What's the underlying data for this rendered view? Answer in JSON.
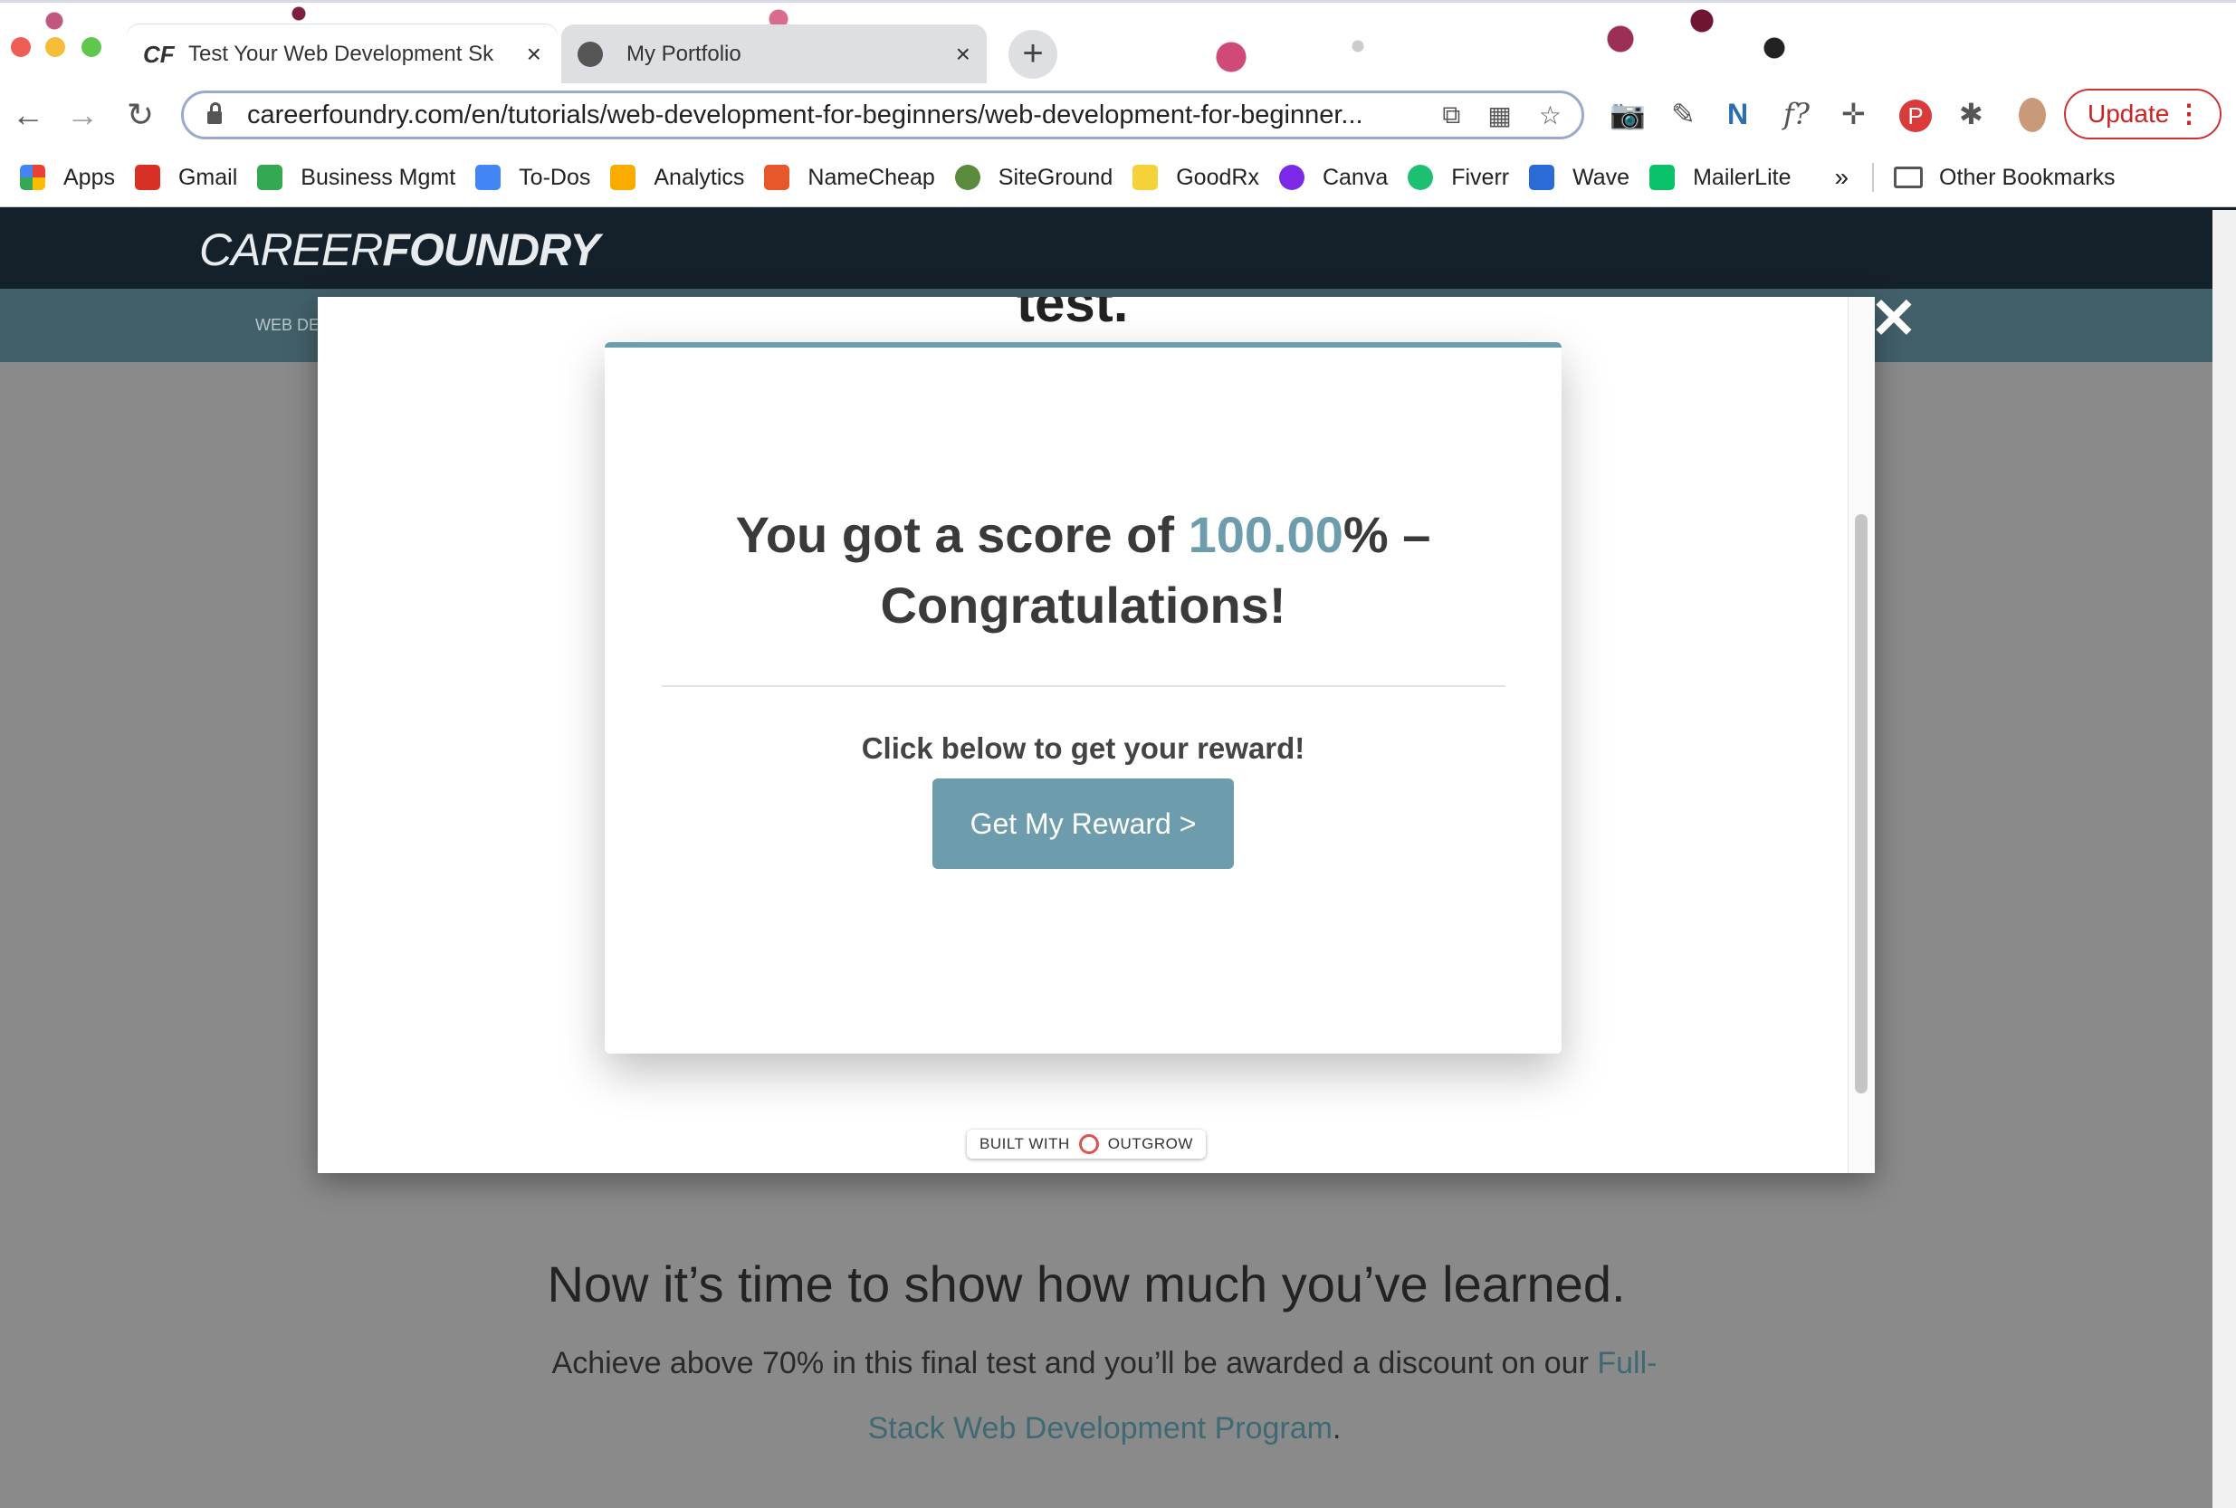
{
  "browser": {
    "tabs": [
      {
        "favicon": "CF",
        "title": "Test Your Web Development Sk",
        "close": "×",
        "active": true
      },
      {
        "favicon": "globe-icon",
        "title": "My Portfolio",
        "close": "×",
        "active": false
      }
    ],
    "new_tab": "+",
    "nav": {
      "back": "←",
      "forward": "→",
      "reload": "↻"
    },
    "url": "careerfoundry.com/en/tutorials/web-development-for-beginners/web-development-for-beginner...",
    "omnibox_icons": [
      "⧉",
      "▦",
      "☆"
    ],
    "extensions": [
      "📷",
      "✎",
      "N",
      "f?",
      "✛",
      "P",
      "✱"
    ],
    "update_label": "Update",
    "update_menu": "⋮"
  },
  "bookmarks": {
    "items": [
      {
        "label": "Apps",
        "color": "#e94235"
      },
      {
        "label": "Gmail",
        "color": "#d93025"
      },
      {
        "label": "Business Mgmt",
        "color": "#34a853"
      },
      {
        "label": "To-Dos",
        "color": "#4285f4"
      },
      {
        "label": "Analytics",
        "color": "#f9ab00"
      },
      {
        "label": "NameCheap",
        "color": "#e8572a"
      },
      {
        "label": "SiteGround",
        "color": "#5a8a3c"
      },
      {
        "label": "GoodRx",
        "color": "#f5d23a"
      },
      {
        "label": "Canva",
        "color": "#7d2ae8"
      },
      {
        "label": "Fiverr",
        "color": "#1dbf73"
      },
      {
        "label": "Wave",
        "color": "#2b6bd6"
      },
      {
        "label": "MailerLite",
        "color": "#09c269"
      }
    ],
    "more": "»",
    "other": "Other Bookmarks"
  },
  "site": {
    "logo_light": "CAREER",
    "logo_bold": "FOUNDRY",
    "subnav_text": "WEB DE",
    "heading": "Now it’s time to show how much you’ve learned.",
    "para_text": "Achieve above 70% in this final test and you’ll be awarded a discount on our ",
    "para_link": "Full-Stack Web Development Program",
    "para_end": "."
  },
  "modal": {
    "peek_text": "test.",
    "close": "✕",
    "score_prefix": "You got a score of ",
    "score_value": "100.00",
    "score_suffix": "% –",
    "congrats": "Congratulations!",
    "reward_prompt": "Click below to get your reward!",
    "reward_button": "Get My Reward >",
    "built_with": "BUILT WITH",
    "built_brand": "OUTGROW"
  },
  "colors": {
    "accent": "#6d9dad",
    "header": "#14212a",
    "subnav": "#42606a"
  }
}
